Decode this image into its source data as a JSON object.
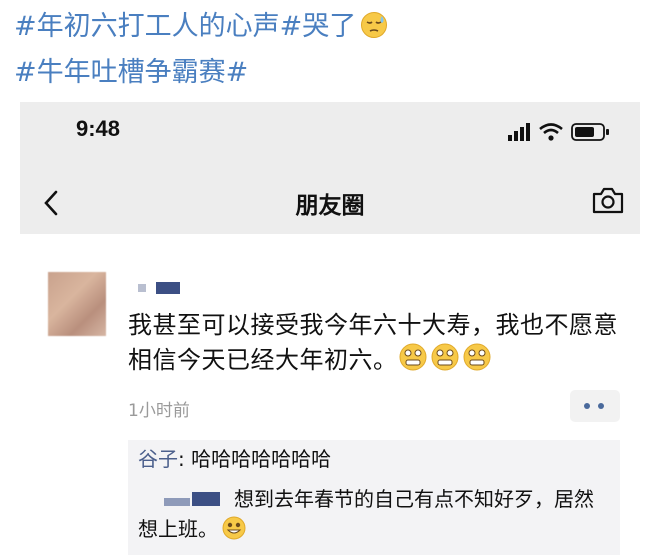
{
  "hashtags": {
    "line1": "#年初六打工人的心声#哭了",
    "line2": "#牛年吐槽争霸赛#"
  },
  "status_bar": {
    "time": "9:48"
  },
  "nav": {
    "title": "朋友圈"
  },
  "post": {
    "text": "我甚至可以接受我今年六十大寿，我也不愿意相信今天已经大年初六。",
    "time": "1小时前"
  },
  "comments": [
    {
      "author": "谷子",
      "separator": ": ",
      "text": "哈哈哈哈哈哈哈"
    },
    {
      "text": "想到去年春节的自己有点不知好歹，居然想上班。"
    }
  ],
  "colors": {
    "hashtag": "#4a7fc0",
    "link_name": "#4b5f8c",
    "emoji": "#f2c94c"
  }
}
